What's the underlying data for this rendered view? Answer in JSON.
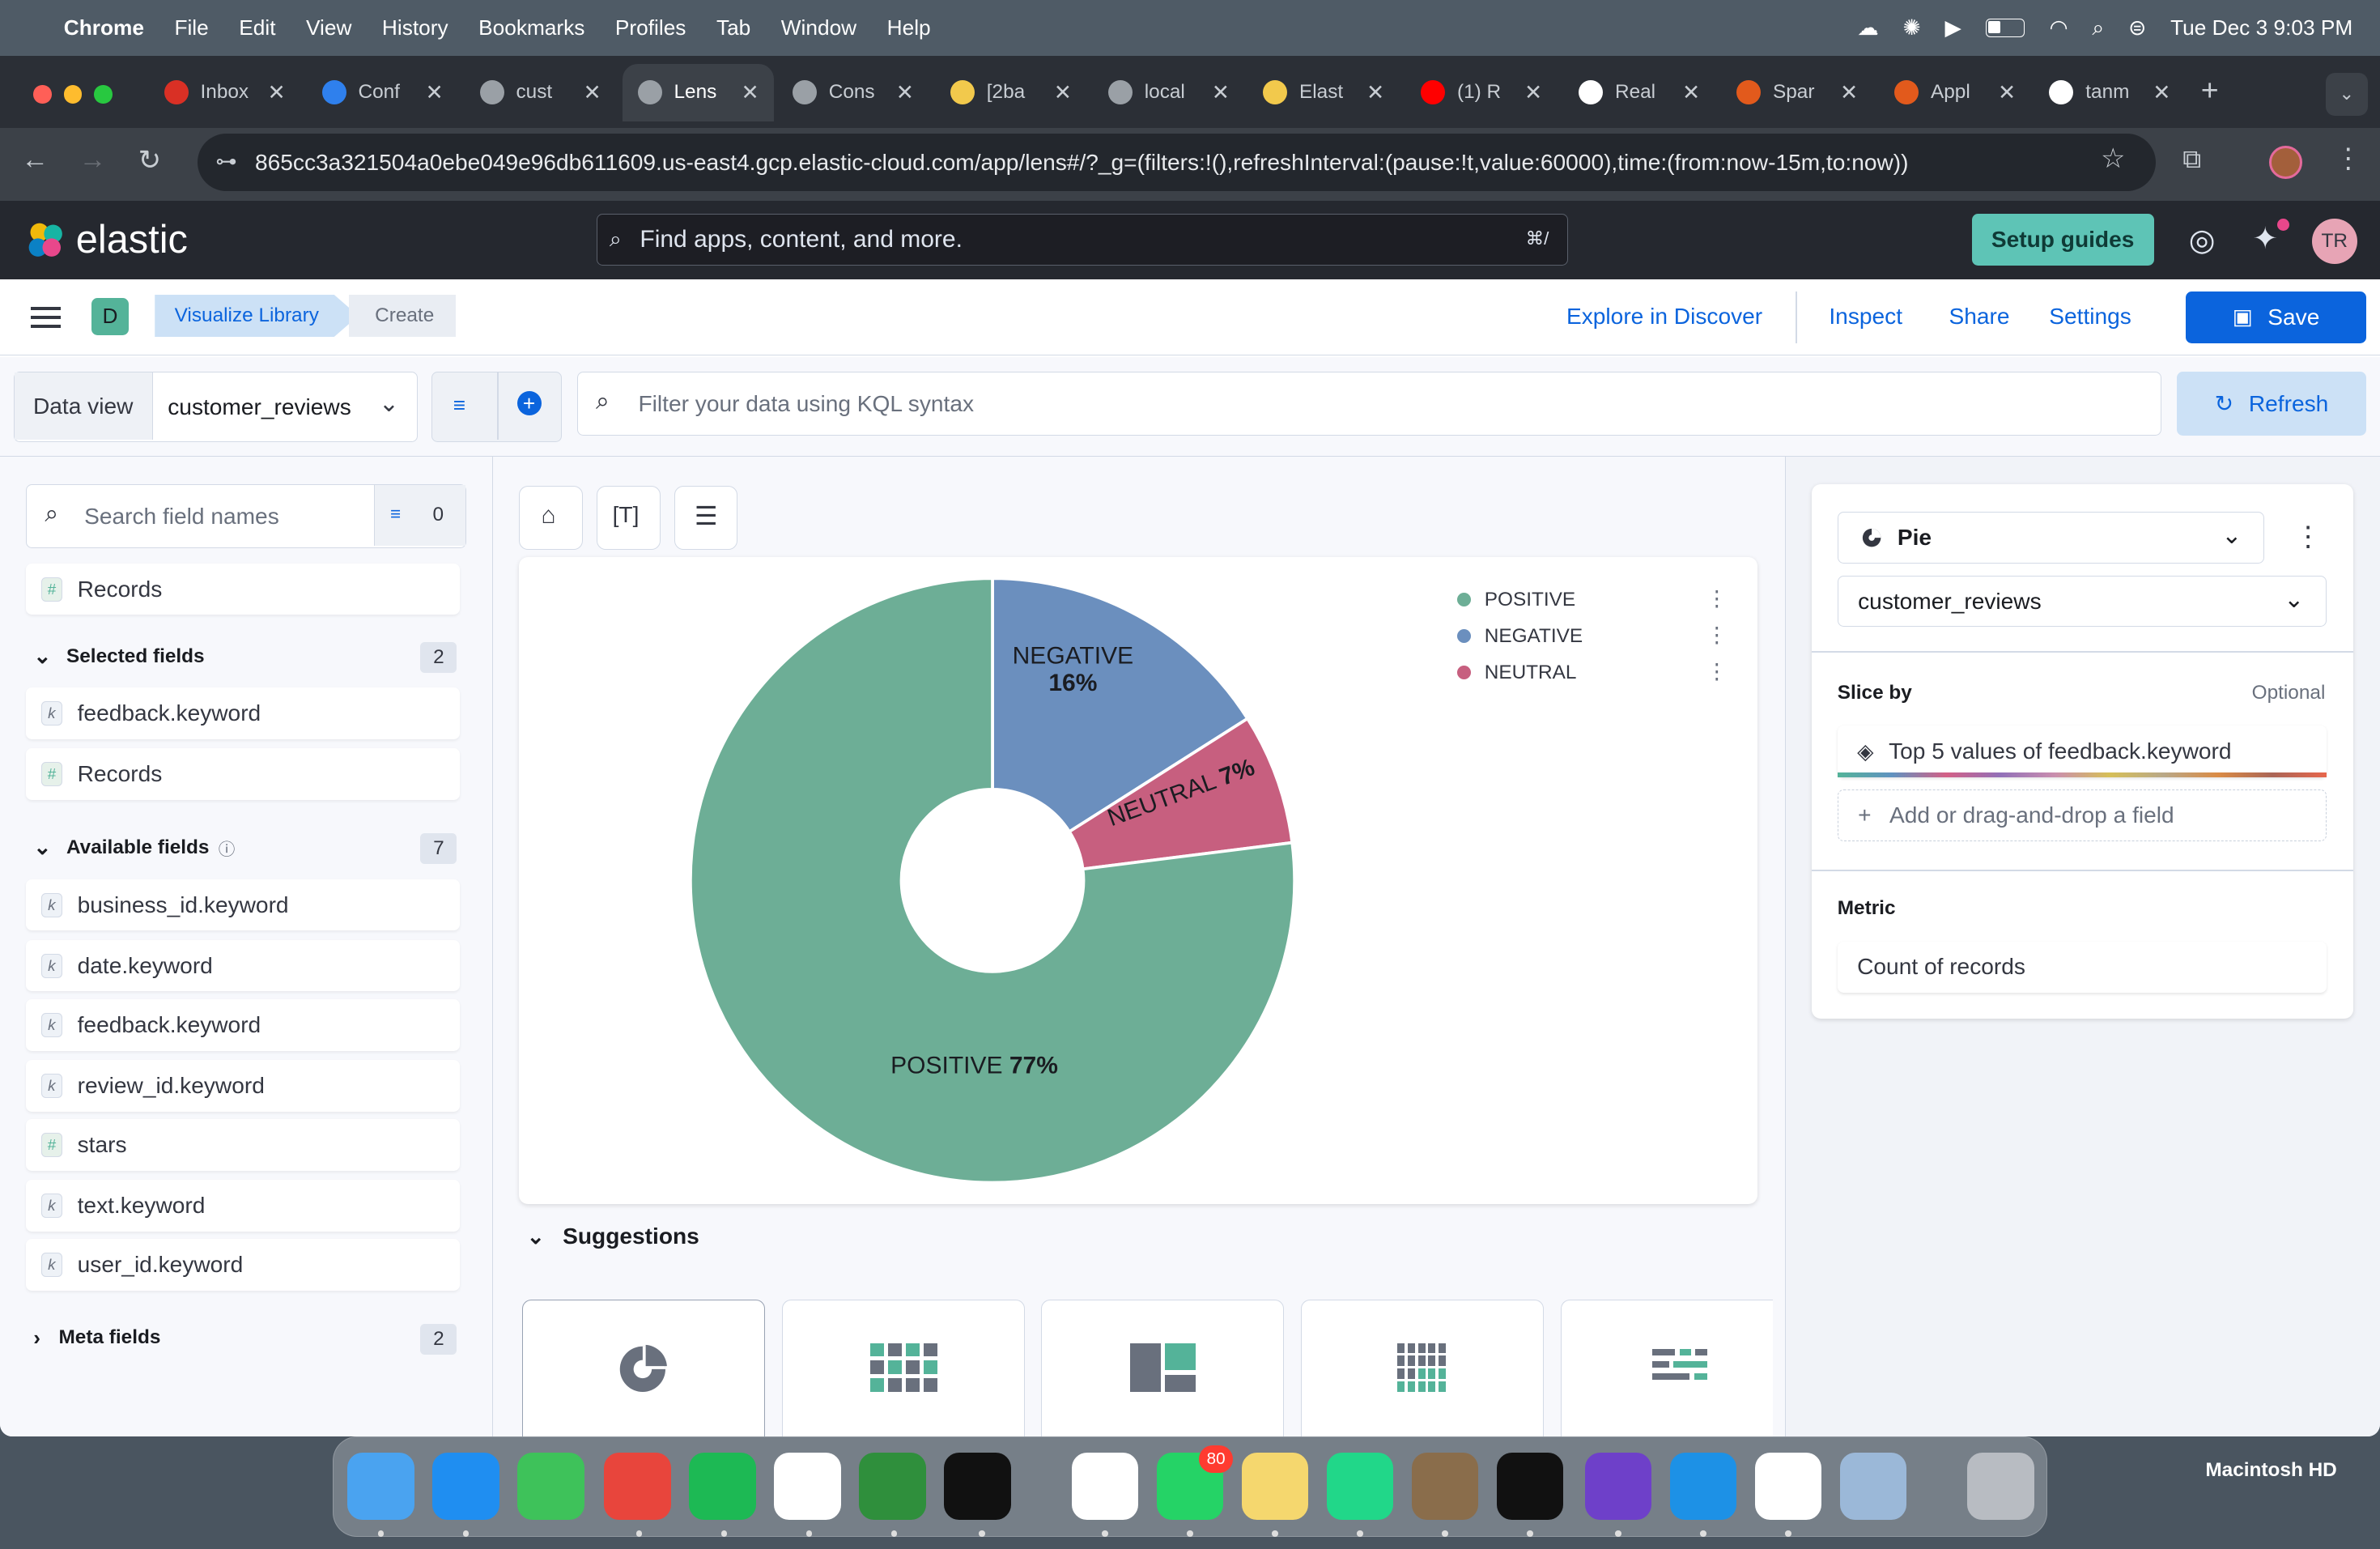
{
  "menubar": {
    "app": "Chrome",
    "items": [
      "File",
      "Edit",
      "View",
      "History",
      "Bookmarks",
      "Profiles",
      "Tab",
      "Window",
      "Help"
    ],
    "datetime": "Tue Dec 3  9:03 PM"
  },
  "browser": {
    "tabs": [
      {
        "title": "Inbox",
        "color": "#d93025"
      },
      {
        "title": "Conf",
        "color": "#2f80ed"
      },
      {
        "title": "cust",
        "color": "#9aa0a6"
      },
      {
        "title": "Lens",
        "color": "#9aa0a6"
      },
      {
        "title": "Cons",
        "color": "#9aa0a6"
      },
      {
        "title": "[2ba",
        "color": "#f2c94c"
      },
      {
        "title": "local",
        "color": "#9aa0a6"
      },
      {
        "title": "Elast",
        "color": "#f2c94c"
      },
      {
        "title": "(1) R",
        "color": "#ff0000"
      },
      {
        "title": "Real",
        "color": "#ffffff"
      },
      {
        "title": "Spar",
        "color": "#e25a1c"
      },
      {
        "title": "Appl",
        "color": "#e25a1c"
      },
      {
        "title": "tanm",
        "color": "#ffffff"
      }
    ],
    "active_tab_index": 3,
    "url": "865cc3a321504a0ebe049e96db611609.us-east4.gcp.elastic-cloud.com/app/lens#/?_g=(filters:!(),refreshInterval:(pause:!t,value:60000),time:(from:now-15m,to:now))"
  },
  "elastic": {
    "logo": "elastic",
    "search_placeholder": "Find apps, content, and more.",
    "search_shortcut": "⌘/",
    "setup_guides": "Setup guides",
    "avatar": "TR",
    "space_badge": "D",
    "breadcrumb": [
      "Visualize Library",
      "Create"
    ],
    "actions": {
      "explore": "Explore in Discover",
      "inspect": "Inspect",
      "share": "Share",
      "settings": "Settings",
      "save": "Save"
    }
  },
  "query": {
    "data_view_label": "Data view",
    "data_view": "customer_reviews",
    "kql_placeholder": "Filter your data using KQL syntax",
    "refresh": "Refresh"
  },
  "fields": {
    "search_placeholder": "Search field names",
    "filter_count": "0",
    "records": "Records",
    "selected_label": "Selected fields",
    "selected_count": "2",
    "selected": [
      {
        "type": "k",
        "name": "feedback.keyword"
      },
      {
        "type": "#",
        "name": "Records"
      }
    ],
    "available_label": "Available fields",
    "available_count": "7",
    "available": [
      {
        "type": "k",
        "name": "business_id.keyword"
      },
      {
        "type": "k",
        "name": "date.keyword"
      },
      {
        "type": "k",
        "name": "feedback.keyword"
      },
      {
        "type": "k",
        "name": "review_id.keyword"
      },
      {
        "type": "#",
        "name": "stars"
      },
      {
        "type": "k",
        "name": "text.keyword"
      },
      {
        "type": "k",
        "name": "user_id.keyword"
      }
    ],
    "meta_label": "Meta fields",
    "meta_count": "2"
  },
  "chart_data": {
    "type": "pie",
    "donut": true,
    "categories": [
      "POSITIVE",
      "NEGATIVE",
      "NEUTRAL"
    ],
    "values": [
      77,
      16,
      7
    ],
    "labels": [
      "POSITIVE 77%",
      "NEGATIVE 16%",
      "NEUTRAL 7%"
    ],
    "colors": [
      "#6dae96",
      "#6b8fbe",
      "#c75f7f"
    ],
    "legend": "top-right"
  },
  "suggestions_label": "Suggestions",
  "config": {
    "chart_type": "Pie",
    "data_view": "customer_reviews",
    "slice_by_label": "Slice by",
    "optional": "Optional",
    "slice_by_value": "Top 5 values of feedback.keyword",
    "add_field": "Add or drag-and-drop a field",
    "metric_label": "Metric",
    "metric_value": "Count of records"
  },
  "desktop": {
    "disk_label": "Macintosh HD",
    "whatsapp_badge": "80"
  }
}
